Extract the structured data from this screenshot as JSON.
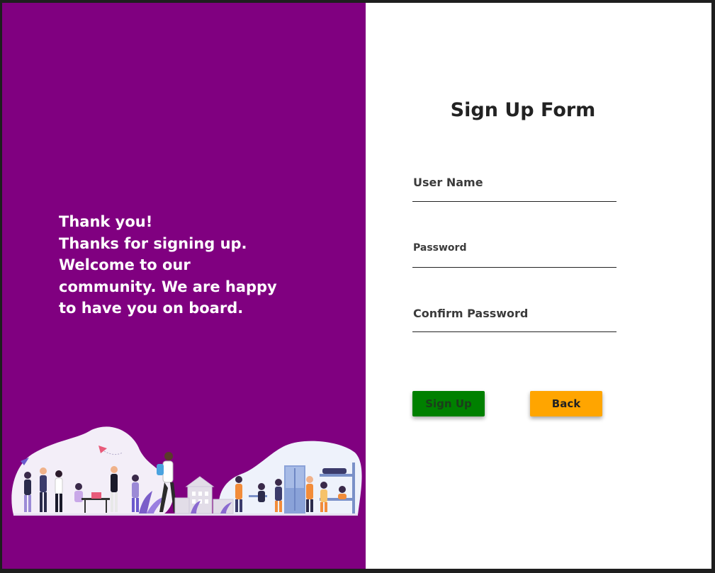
{
  "welcome": {
    "lines": [
      "Thank you!",
      "Thanks for signing up.",
      "Welcome to our",
      "community. We are happy",
      "to have you on board."
    ]
  },
  "form": {
    "title": "Sign Up Form",
    "fields": {
      "username": {
        "label": "User Name",
        "value": ""
      },
      "password": {
        "label": "Password",
        "value": ""
      },
      "confirm": {
        "label": "Confirm Password",
        "value": ""
      }
    },
    "signup_label": "Sign Up",
    "back_label": "Back"
  },
  "colors": {
    "panel": "#800080",
    "signup_button": "#008000",
    "back_button": "#ffa500"
  },
  "icons": [
    "community-illustration"
  ]
}
